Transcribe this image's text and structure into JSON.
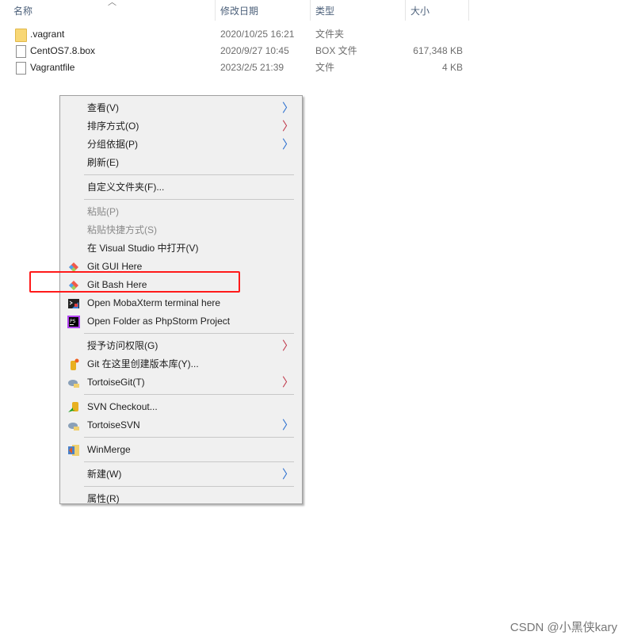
{
  "columns": {
    "name": "名称",
    "modified": "修改日期",
    "type": "类型",
    "size": "大小"
  },
  "files": [
    {
      "name": ".vagrant",
      "modified": "2020/10/25 16:21",
      "type": "文件夹",
      "size": "",
      "icon": "folder-icon"
    },
    {
      "name": "CentOS7.8.box",
      "modified": "2020/9/27 10:45",
      "type": "BOX 文件",
      "size": "617,348 KB",
      "icon": "file-icon"
    },
    {
      "name": "Vagrantfile",
      "modified": "2023/2/5 21:39",
      "type": "文件",
      "size": "4 KB",
      "icon": "file-icon"
    }
  ],
  "menu": {
    "view": "查看(V)",
    "sort": "排序方式(O)",
    "group": "分组依据(P)",
    "refresh": "刷新(E)",
    "customize": "自定义文件夹(F)...",
    "paste": "粘贴(P)",
    "paste_shortcut": "粘贴快捷方式(S)",
    "open_vs": "在 Visual Studio 中打开(V)",
    "git_gui": "Git GUI Here",
    "git_bash": "Git Bash Here",
    "moba": "Open MobaXterm terminal here",
    "phpstorm": "Open Folder as PhpStorm Project",
    "grant": "授予访问权限(G)",
    "git_create": "Git 在这里创建版本库(Y)...",
    "tortoisegit": "TortoiseGit(T)",
    "svn_checkout": "SVN Checkout...",
    "tortoisesvn": "TortoiseSVN",
    "winmerge": "WinMerge",
    "new": "新建(W)",
    "properties": "属性(R)"
  },
  "highlight_color": "#ff1a1a",
  "watermark": "CSDN @小黑侠kary"
}
